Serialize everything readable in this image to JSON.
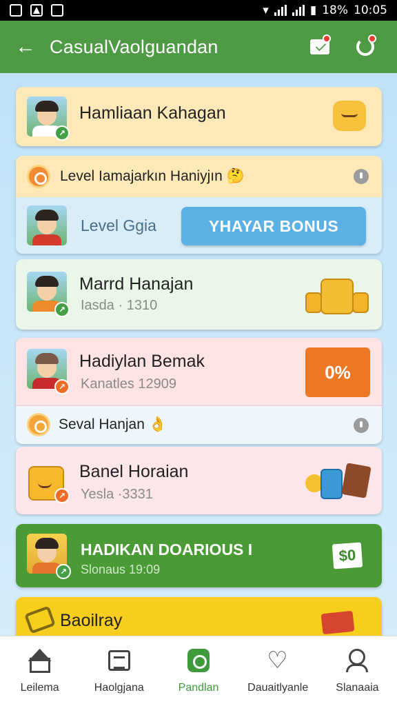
{
  "status_bar": {
    "battery": "18%",
    "time": "10:05"
  },
  "app_bar": {
    "back_glyph": "←",
    "title": "CasualVaolguandan"
  },
  "cards": {
    "profile": {
      "title": "Hamliaan Kahagan",
      "icon": "cat-mascot-icon"
    },
    "level_header": {
      "title": "Level Iamajarkın Haniyjın",
      "emoji": "🤔"
    },
    "level": {
      "label": "Level Ggia",
      "bonus_button": "YHAYAR BONUS"
    },
    "reward1": {
      "title": "Marrd Hanajan",
      "subtitle": "Iasda · 1310"
    },
    "reward2": {
      "title": "Hadiylan Bemak",
      "subtitle": "Kanatles 12909",
      "percent": "0%"
    },
    "section2": {
      "title": "Seval Hanjan",
      "emoji": "👌"
    },
    "banel": {
      "title": "Banel Horaian",
      "subtitle": "Yesla ·3331"
    },
    "green": {
      "title": "HADIKAN DOARIOUS I",
      "subtitle": "Slonaus 19:09",
      "cash": "$0"
    },
    "yellow": {
      "title": "Baoilray"
    }
  },
  "tabs": [
    {
      "label": "Leilema",
      "icon": "home-icon"
    },
    {
      "label": "Haolgjana",
      "icon": "newspaper-icon"
    },
    {
      "label": "Pandlan",
      "icon": "gift-icon"
    },
    {
      "label": "Dauaitlyanle",
      "icon": "heart-icon"
    },
    {
      "label": "Slanaaia",
      "icon": "people-icon"
    }
  ],
  "colors": {
    "app_bar": "#4f9a45",
    "accent_blue": "#5bb0e4",
    "accent_orange": "#ec7826",
    "active_tab": "#3e9a3a"
  }
}
